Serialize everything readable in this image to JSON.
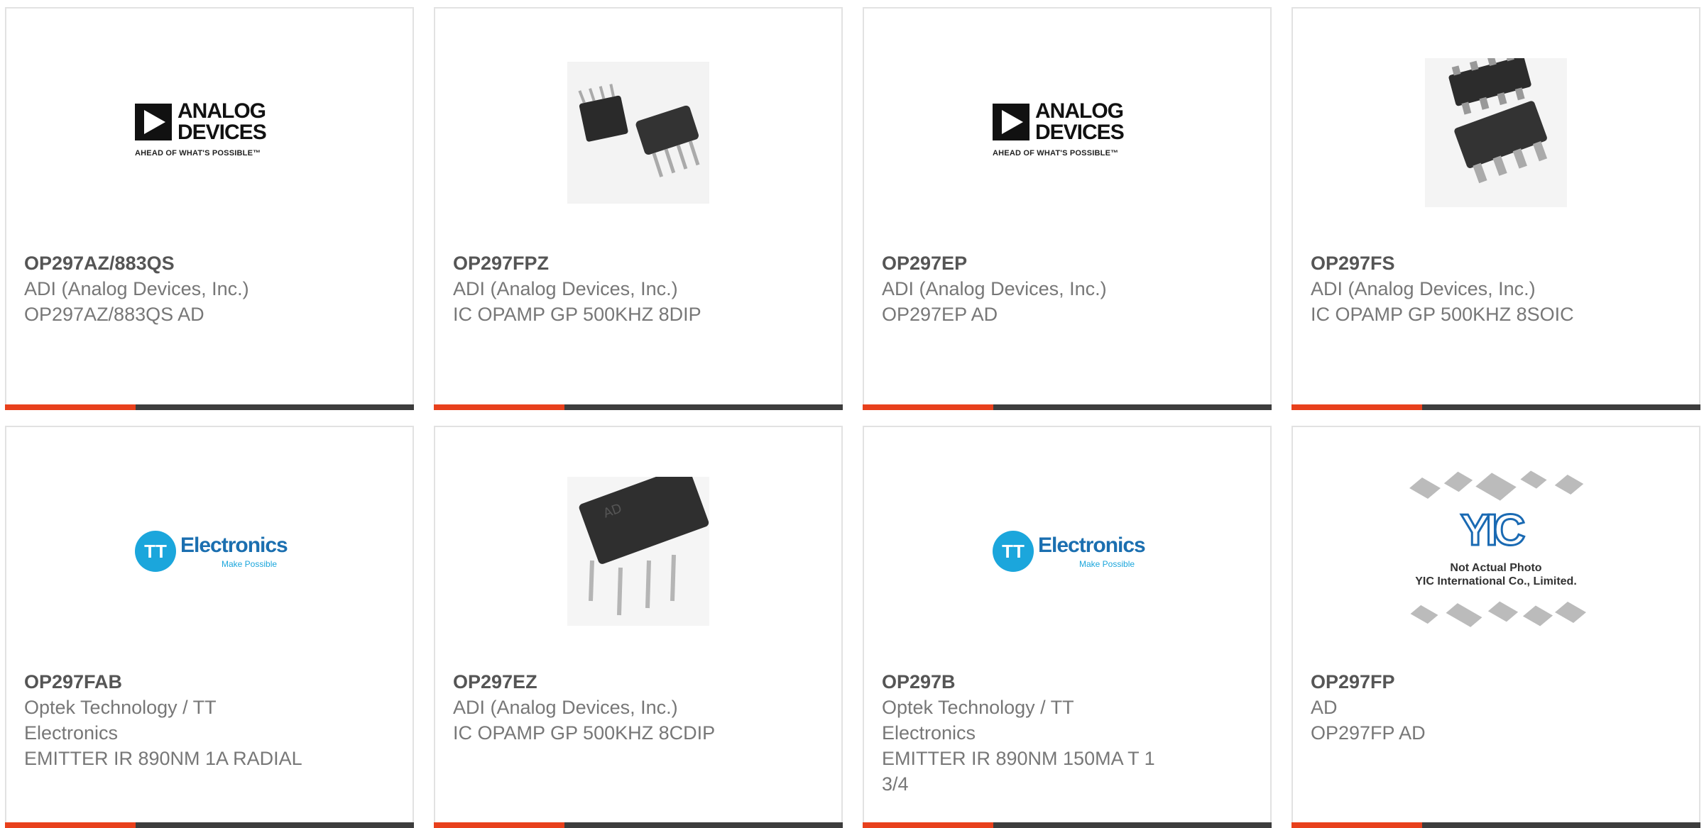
{
  "products": [
    {
      "part": "OP297AZ/883QS",
      "manufacturer": "ADI (Analog Devices, Inc.)",
      "description": "OP297AZ/883QS AD",
      "image": "analog-devices-logo"
    },
    {
      "part": "OP297FPZ",
      "manufacturer": "ADI (Analog Devices, Inc.)",
      "description": "IC OPAMP GP 500KHZ 8DIP",
      "image": "dip8-chip-photo"
    },
    {
      "part": "OP297EP",
      "manufacturer": "ADI (Analog Devices, Inc.)",
      "description": "OP297EP AD",
      "image": "analog-devices-logo"
    },
    {
      "part": "OP297FS",
      "manufacturer": "ADI (Analog Devices, Inc.)",
      "description": "IC OPAMP GP 500KHZ 8SOIC",
      "image": "soic8-chip-photo"
    },
    {
      "part": "OP297FAB",
      "manufacturer": "Optek Technology / TT Electronics",
      "description": "EMITTER IR 890NM 1A RADIAL",
      "image": "tt-electronics-logo"
    },
    {
      "part": "OP297EZ",
      "manufacturer": "ADI (Analog Devices, Inc.)",
      "description": "IC OPAMP GP 500KHZ 8CDIP",
      "image": "cdip8-chip-photo"
    },
    {
      "part": "OP297B",
      "manufacturer": "Optek Technology / TT Electronics",
      "description": "EMITTER IR 890NM 150MA T 1 3/4",
      "image": "tt-electronics-logo"
    },
    {
      "part": "OP297FP",
      "manufacturer": "AD",
      "description": "OP297FP AD",
      "image": "not-actual-photo-placeholder"
    }
  ],
  "logos": {
    "adi_name_line1": "ANALOG",
    "adi_name_line2": "DEVICES",
    "adi_tagline": "AHEAD OF WHAT'S POSSIBLE™",
    "tt_mark": "TT",
    "tt_word": "Electronics",
    "tt_tagline": "Make Possible",
    "yic_mark": "YIC",
    "yic_line1": "Not Actual Photo",
    "yic_line2": "YIC International Co., Limited."
  },
  "colors": {
    "accent": "#e8401c",
    "bar": "#3d3d3d",
    "border": "#e2e2e2"
  }
}
